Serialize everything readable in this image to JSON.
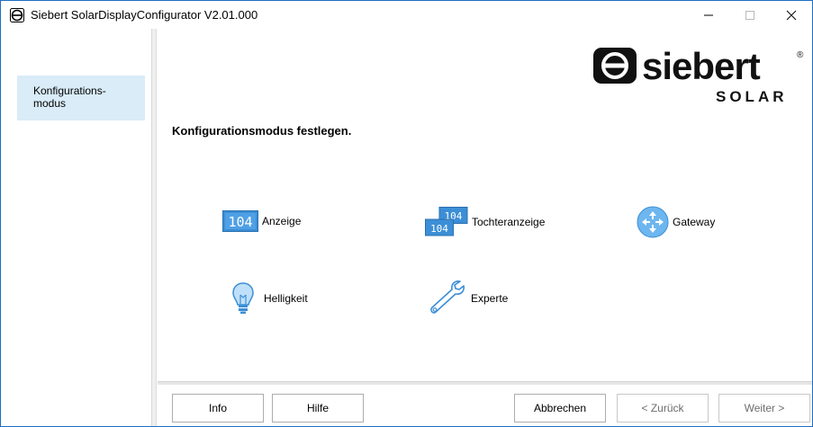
{
  "window": {
    "title": "Siebert SolarDisplayConfigurator V2.01.000"
  },
  "sidebar": {
    "items": [
      {
        "label": "Konfigurations-\nmodus",
        "selected": true
      }
    ]
  },
  "logo": {
    "brand": "siebert",
    "sub": "SOLAR",
    "registered": "®"
  },
  "main": {
    "title": "Konfigurationsmodus festlegen.",
    "options": [
      {
        "label": "Anzeige",
        "icon": "display-104-icon"
      },
      {
        "label": "Tochteranzeige",
        "icon": "double-display-104-icon"
      },
      {
        "label": "Gateway",
        "icon": "gateway-arrows-icon"
      },
      {
        "label": "Helligkeit",
        "icon": "lightbulb-icon"
      },
      {
        "label": "Experte",
        "icon": "wrench-icon"
      }
    ],
    "display_digits": "104"
  },
  "buttons": {
    "info": "Info",
    "hilfe": "Hilfe",
    "abbrechen": "Abbrechen",
    "zurueck": "< Zurück",
    "weiter": "Weiter >"
  },
  "colors": {
    "accent": "#3c8fd6",
    "sidebar_selected": "#d9ecf8",
    "window_border": "#1f6fc4"
  }
}
